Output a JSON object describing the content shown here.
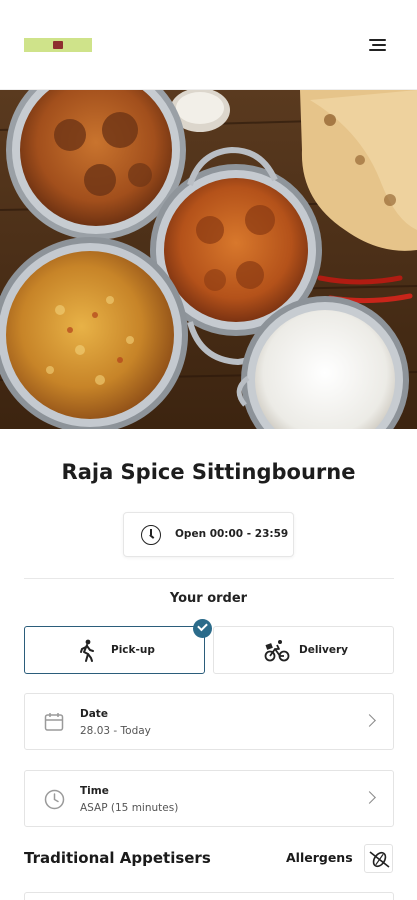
{
  "header": {
    "logo_alt": "Raja Spice logo",
    "menu_icon": "hamburger-menu-icon"
  },
  "hero": {
    "image_alt": "Indian curries, biryani, naan and rice"
  },
  "restaurant": {
    "name": "Raja Spice Sittingbourne",
    "hours": "Open 00:00 - 23:59"
  },
  "order": {
    "section_label": "Your order",
    "options": [
      {
        "label": "Pick-up",
        "icon": "walking-person-icon",
        "selected": true
      },
      {
        "label": "Delivery",
        "icon": "bicycle-delivery-icon",
        "selected": false
      }
    ],
    "date": {
      "label": "Date",
      "value": "28.03 - Today",
      "icon": "calendar-icon"
    },
    "time": {
      "label": "Time",
      "value": "ASAP (15 minutes)",
      "icon": "clock-icon"
    }
  },
  "menu": {
    "category_title": "Traditional Appetisers",
    "allergens_label": "Allergens",
    "allergens_icon": "no-allergen-icon"
  },
  "colors": {
    "accent": "#2b6b8a",
    "logo_bg": "#cfe38a"
  }
}
